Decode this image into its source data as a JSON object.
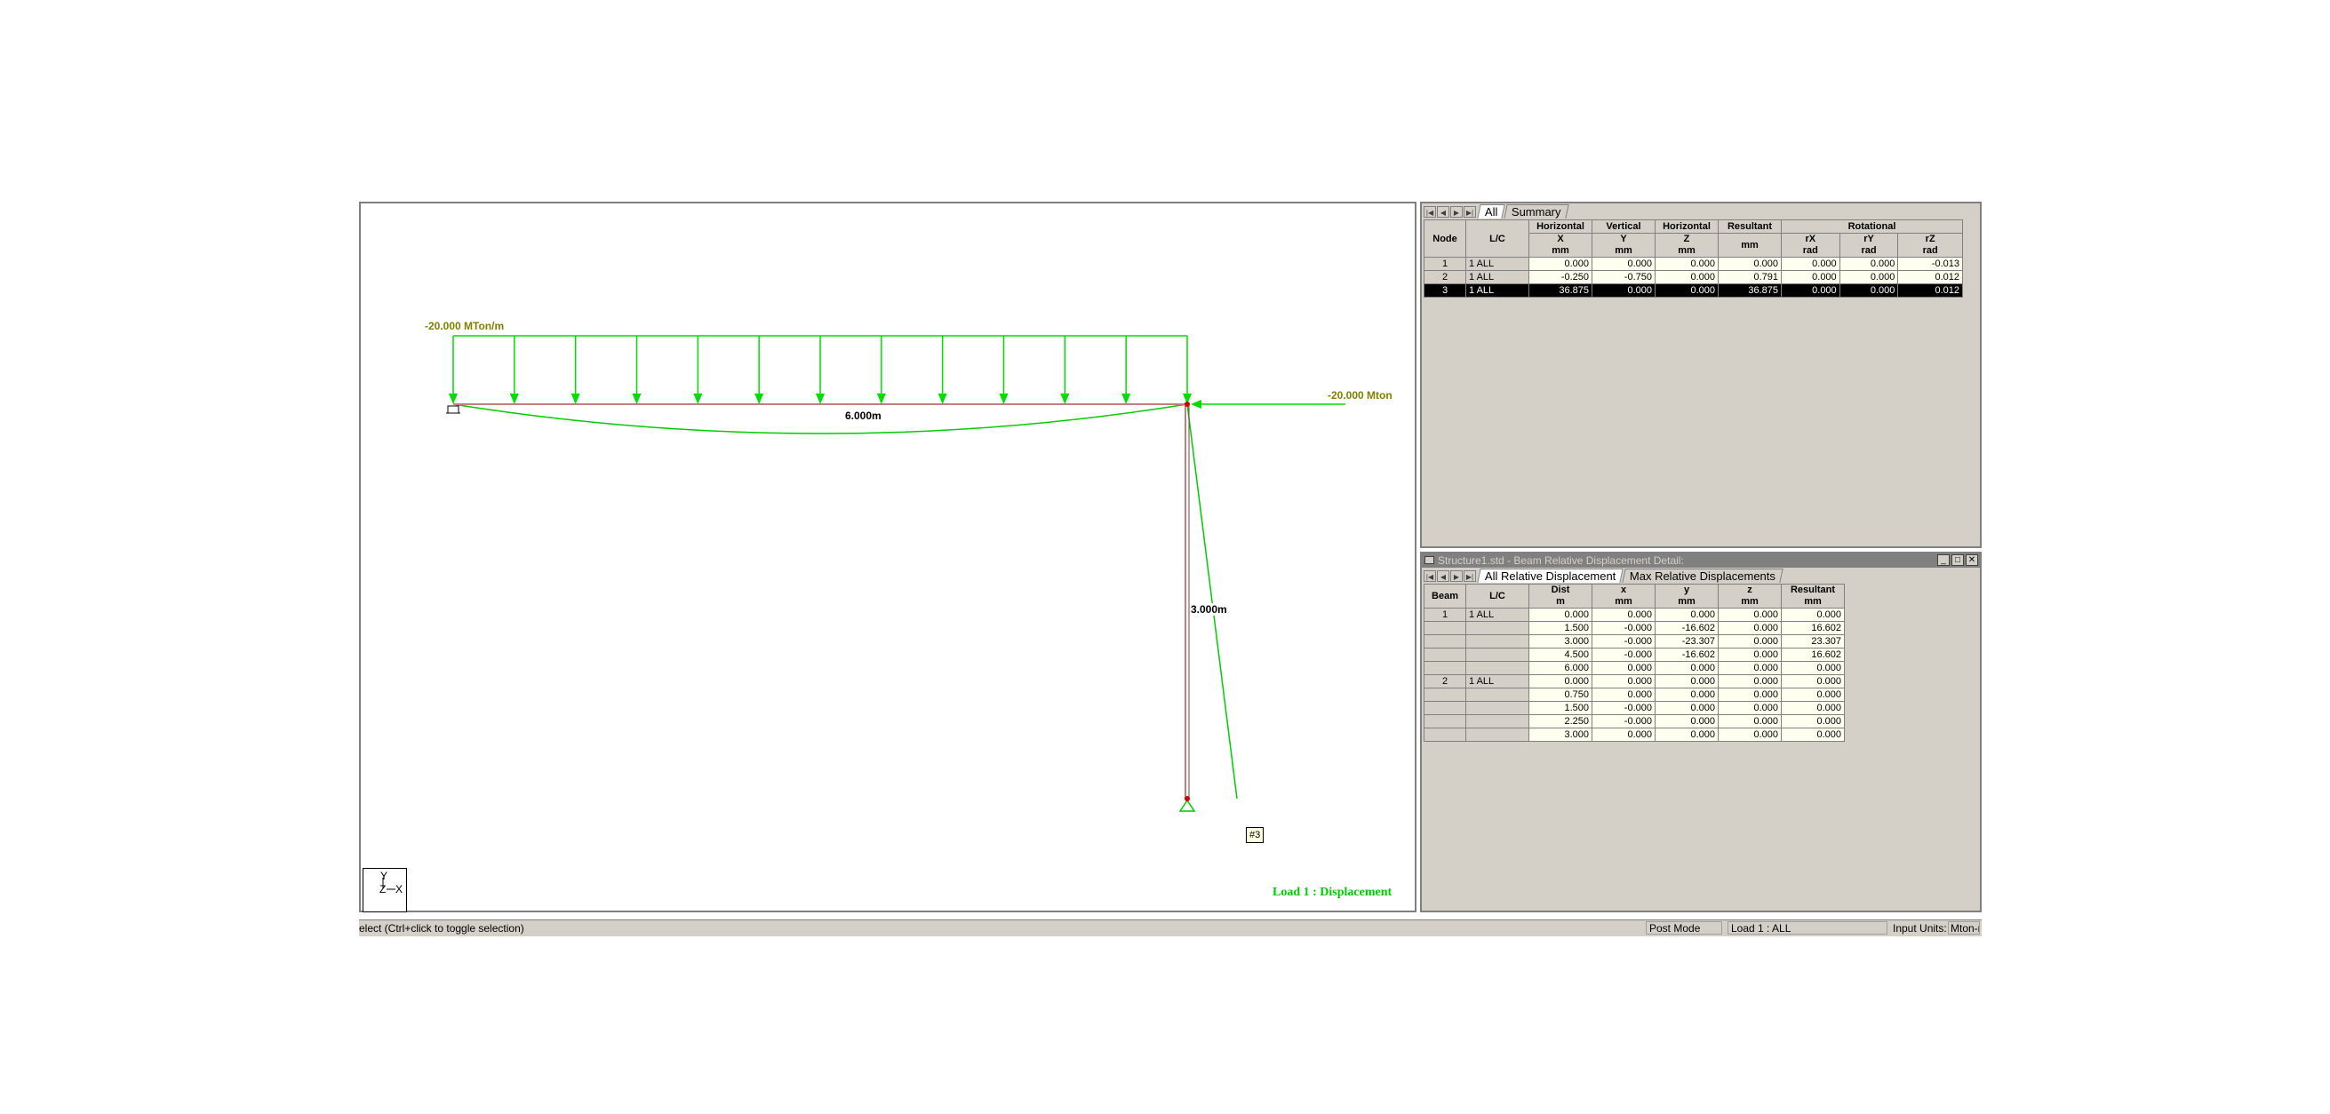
{
  "viewport": {
    "udl_label": "-20.000 MTon/m",
    "point_load_label": "-20.000 Mton",
    "beam1_length_label": "6.000m",
    "column_length_label": "3.000m",
    "node_tag": "#3",
    "load_caption": "Load 1 : Displacement",
    "axis": {
      "y": "Y",
      "z": "Z",
      "x": "X"
    },
    "colors": {
      "load": "#00dd00",
      "label": "#808000",
      "member": "#c08080",
      "deflected": "#00cc00"
    }
  },
  "node_panel": {
    "tabs": [
      "All",
      "Summary"
    ],
    "headers_top": [
      "Horizontal",
      "Vertical",
      "Horizontal",
      "Resultant",
      "Rotational"
    ],
    "col_node": "Node",
    "col_lc": "L/C",
    "headers_sub": [
      "X\nmm",
      "Y\nmm",
      "Z\nmm",
      "mm",
      "rX\nrad",
      "rY\nrad",
      "rZ\nrad"
    ],
    "rows": [
      {
        "node": "1",
        "lc": "1 ALL",
        "x": "0.000",
        "y": "0.000",
        "z": "0.000",
        "res": "0.000",
        "rx": "0.000",
        "ry": "0.000",
        "rz": "-0.013"
      },
      {
        "node": "2",
        "lc": "1 ALL",
        "x": "-0.250",
        "y": "-0.750",
        "z": "0.000",
        "res": "0.791",
        "rx": "0.000",
        "ry": "0.000",
        "rz": "0.012"
      },
      {
        "node": "3",
        "lc": "1 ALL",
        "x": "36.875",
        "y": "0.000",
        "z": "0.000",
        "res": "36.875",
        "rx": "0.000",
        "ry": "0.000",
        "rz": "0.012"
      }
    ]
  },
  "beam_panel": {
    "title": "Structure1.std - Beam Relative Displacement Detail:",
    "tabs": [
      "All Relative Displacement",
      "Max Relative Displacements"
    ],
    "headers": [
      "Beam",
      "L/C",
      "Dist\nm",
      "x\nmm",
      "y\nmm",
      "z\nmm",
      "Resultant\nmm"
    ],
    "rows": [
      {
        "beam": "1",
        "lc": "1 ALL",
        "dist": "0.000",
        "x": "0.000",
        "y": "0.000",
        "z": "0.000",
        "res": "0.000"
      },
      {
        "beam": "",
        "lc": "",
        "dist": "1.500",
        "x": "-0.000",
        "y": "-16.602",
        "z": "0.000",
        "res": "16.602"
      },
      {
        "beam": "",
        "lc": "",
        "dist": "3.000",
        "x": "-0.000",
        "y": "-23.307",
        "z": "0.000",
        "res": "23.307"
      },
      {
        "beam": "",
        "lc": "",
        "dist": "4.500",
        "x": "-0.000",
        "y": "-16.602",
        "z": "0.000",
        "res": "16.602"
      },
      {
        "beam": "",
        "lc": "",
        "dist": "6.000",
        "x": "0.000",
        "y": "0.000",
        "z": "0.000",
        "res": "0.000"
      },
      {
        "beam": "2",
        "lc": "1 ALL",
        "dist": "0.000",
        "x": "0.000",
        "y": "0.000",
        "z": "0.000",
        "res": "0.000"
      },
      {
        "beam": "",
        "lc": "",
        "dist": "0.750",
        "x": "0.000",
        "y": "0.000",
        "z": "0.000",
        "res": "0.000"
      },
      {
        "beam": "",
        "lc": "",
        "dist": "1.500",
        "x": "-0.000",
        "y": "0.000",
        "z": "0.000",
        "res": "0.000"
      },
      {
        "beam": "",
        "lc": "",
        "dist": "2.250",
        "x": "-0.000",
        "y": "0.000",
        "z": "0.000",
        "res": "0.000"
      },
      {
        "beam": "",
        "lc": "",
        "dist": "3.000",
        "x": "0.000",
        "y": "0.000",
        "z": "0.000",
        "res": "0.000"
      }
    ]
  },
  "statusbar": {
    "hint": "elect (Ctrl+click to toggle selection)",
    "mode": "Post Mode",
    "load": "Load 1 : ALL",
    "units_label": "Input Units:",
    "units_value": "Mton-m"
  }
}
